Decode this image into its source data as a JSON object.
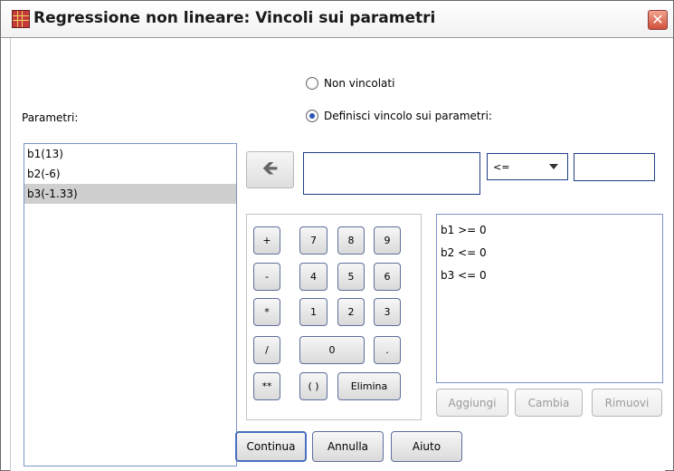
{
  "window": {
    "title": "Regressione non lineare: Vincoli sui parametri",
    "close_glyph": "✕"
  },
  "radios": {
    "unconstrained": {
      "label": "Non vincolati",
      "checked": false
    },
    "define": {
      "label": "Definisci vincolo sui parametri:",
      "checked": true
    }
  },
  "parameters": {
    "label": "Parametri:",
    "items": [
      "b1(13)",
      "b2(-6)",
      "b3(-1.33)"
    ],
    "selected": "b3(-1.33)"
  },
  "constraint_editor": {
    "move_icon": "left-return-arrow-icon",
    "expression_value": "",
    "operator": "<=",
    "operator_value_text": ""
  },
  "keypad": {
    "plus": "+",
    "seven": "7",
    "eight": "8",
    "nine": "9",
    "minus": "-",
    "four": "4",
    "five": "5",
    "six": "6",
    "multiply": "*",
    "one": "1",
    "two": "2",
    "three": "3",
    "divide": "/",
    "zero": "0",
    "dot": ".",
    "power": "**",
    "parens": "( )",
    "delete": "Elimina"
  },
  "constraints_list": [
    "b1 >= 0",
    "b2 <= 0",
    "b3 <= 0"
  ],
  "list_buttons": {
    "add": "Aggiungi",
    "change": "Cambia",
    "remove": "Rimuovi"
  },
  "footer_buttons": {
    "continue": "Continua",
    "cancel": "Annulla",
    "help": "Aiuto"
  },
  "colors": {
    "accent": "#2c53b5",
    "close": "#d0513a"
  }
}
